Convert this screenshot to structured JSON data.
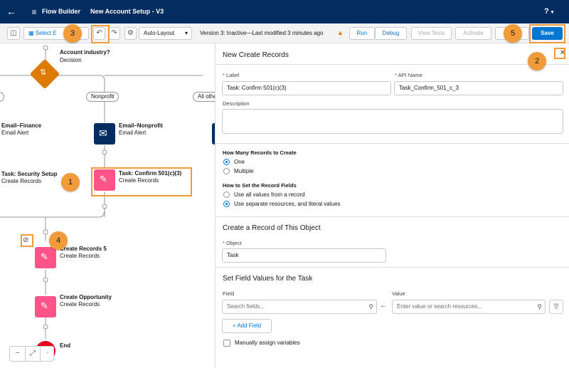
{
  "header": {
    "back_icon": "back-arrow-icon",
    "app_name": "Flow Builder",
    "flow_name": "New Account Setup - V3",
    "help_label": "?"
  },
  "toolbar": {
    "select_label": "Select E",
    "layout_value": "Auto-Layout",
    "version_status": "Version 3: Inactive—Last modified 3 minutes ago",
    "run_label": "Run",
    "debug_label": "Debug",
    "view_tests_label": "View Tests",
    "activate_label": "Activate",
    "save_label": "Save"
  },
  "canvas": {
    "decision": {
      "title": "Account industry?",
      "type": "Decision"
    },
    "branch_nonprofit": "Nonprofit",
    "branch_other": "All othe",
    "email_finance": {
      "title": "Email–Finance",
      "type": "Email Alert"
    },
    "email_nonprofit": {
      "title": "Email–Nonprofit",
      "type": "Email Alert"
    },
    "task_security": {
      "title": "Task: Security Setup",
      "type": "Create Records"
    },
    "task_confirm": {
      "title": "Task: Confirm 501(c)(3)",
      "type": "Create Records"
    },
    "create_records5": {
      "title": "Create Records 5",
      "type": "Create Records"
    },
    "create_opportunity": {
      "title": "Create Opportunity",
      "type": "Create Records"
    },
    "end_label": "End"
  },
  "panel": {
    "title": "New Create Records",
    "label_field": {
      "label": "Label",
      "value": "Task: Confirm 501(c)(3)"
    },
    "api_field": {
      "label": "API Name",
      "value": "Task_Confirm_501_c_3"
    },
    "description_label": "Description",
    "how_many_heading": "How Many Records to Create",
    "how_many_options": [
      "One",
      "Multiple"
    ],
    "how_set_heading": "How to Set the Record Fields",
    "how_set_options": [
      "Use all values from a record",
      "Use separate resources, and literal values"
    ],
    "object_section": "Create a Record of This Object",
    "object_field": {
      "label": "Object",
      "value": "Task"
    },
    "field_values_section": "Set Field Values for the Task",
    "field_col_label": "Field",
    "value_col_label": "Value",
    "field_placeholder": "Search fields...",
    "value_placeholder": "Enter value or search resources...",
    "add_field_label": "Add Field",
    "manual_assign_label": "Manually assign variables"
  },
  "callouts": [
    "1",
    "2",
    "3",
    "4",
    "5"
  ],
  "colors": {
    "header": "#032d60",
    "brand": "#0176d3",
    "decision": "#dd7a01",
    "email": "#032d60",
    "records": "#ff538a",
    "callout": "#f19b3b",
    "end": "#ea001e"
  }
}
